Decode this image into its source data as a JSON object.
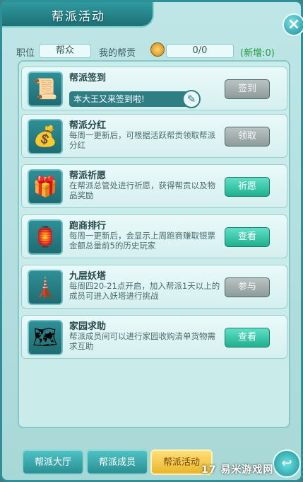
{
  "window": {
    "title": "帮派活动"
  },
  "header": {
    "position_label": "职位",
    "position_value": "帮众",
    "contribution_label": "我的帮贡",
    "contribution_value": "0/0",
    "increase_text": "(新增:0)"
  },
  "activities": [
    {
      "title": "帮派签到",
      "desc": "本大王又来签到啦!",
      "button": "签到",
      "icon": "scroll-book-icon"
    },
    {
      "title": "帮派分红",
      "desc": "每周一更新后，可根据活跃帮贡领取帮派分红",
      "button": "领取",
      "icon": "gold-ingot-icon"
    },
    {
      "title": "帮派祈愿",
      "desc": "在帮派总管处进行祈愿，获得帮贡以及物品奖励",
      "button": "祈愿",
      "icon": "gift-box-icon"
    },
    {
      "title": "跑商排行",
      "desc": "每周一更新后，会显示上周跑商赚取银票金额总量前5的历史玩家",
      "button": "查看",
      "icon": "banner-icon"
    },
    {
      "title": "九层妖塔",
      "desc": "每周四20-21点开启，加入帮派1天以上的成员可进入妖塔进行挑战",
      "button": "参与",
      "icon": "pagoda-icon"
    },
    {
      "title": "家园求助",
      "desc": "帮派成员间可以进行家园收购清单货物需求互助",
      "button": "查看",
      "icon": "scroll-map-icon"
    }
  ],
  "tabs": [
    "帮派大厅",
    "帮派成员",
    "帮派活动"
  ],
  "watermark": "17 易米游戏网",
  "colors": {
    "accent": "#2f8f96",
    "button_green": "#1fb08f",
    "button_gray": "#8e9b9a",
    "active_tab": "#e9b52a"
  }
}
